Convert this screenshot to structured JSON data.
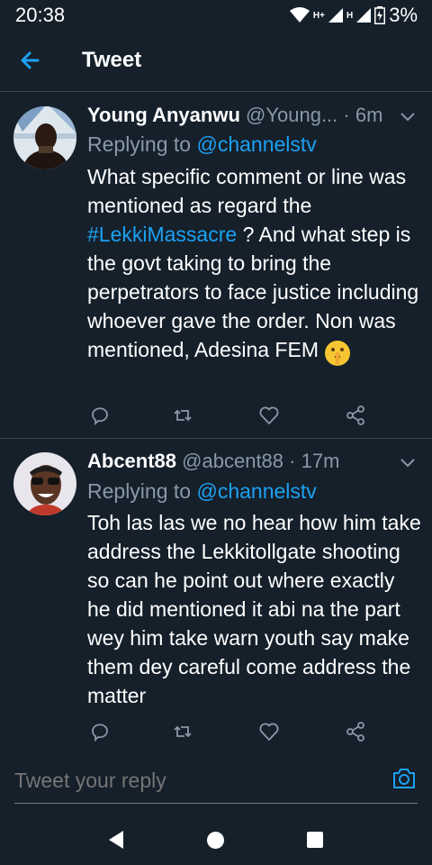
{
  "status_bar": {
    "time": "20:38",
    "network_label": "H+",
    "network_label_2": "H",
    "battery": "3%"
  },
  "header": {
    "title": "Tweet"
  },
  "tweets": [
    {
      "display_name": "Young Anyanwu",
      "handle": "@Young...",
      "time": "· 6m",
      "replying_to_label": "Replying to",
      "replying_to_user": "@channelstv",
      "text_before_hashtag": "What specific comment or line was mentioned as regard the ",
      "hashtag": "#LekkiMassacre",
      "text_after_hashtag": " ? And what step is the govt taking to bring the perpetrators to face justice including whoever gave the order. Non was mentioned, Adesina FEM "
    },
    {
      "display_name": "Abcent88",
      "handle": "@abcent88",
      "time": "· 17m",
      "replying_to_label": "Replying to",
      "replying_to_user": "@channelstv",
      "text": "Toh las las we no hear how him take address the Lekkitollgate shooting so can he point out where exactly he did mentioned it abi na the part wey him take warn youth say make them dey careful come address the matter"
    }
  ],
  "composer": {
    "placeholder": "Tweet your reply"
  },
  "colors": {
    "background": "#15202b",
    "accent": "#1da1f2",
    "secondary_text": "#8899a6",
    "divider": "#38444d"
  },
  "icons": [
    "back-arrow-icon",
    "chevron-down-icon",
    "reply-icon",
    "retweet-icon",
    "like-icon",
    "share-icon",
    "camera-icon",
    "wifi-icon",
    "signal-icon",
    "battery-icon"
  ]
}
